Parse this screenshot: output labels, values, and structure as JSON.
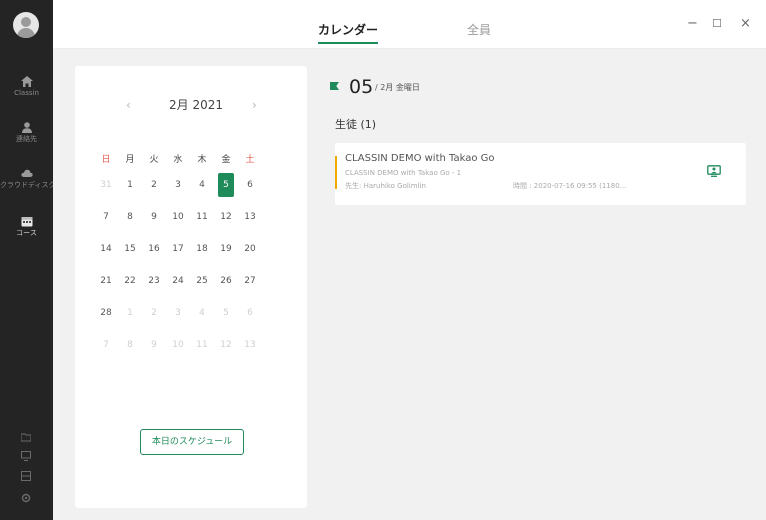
{
  "sidebar": {
    "items": [
      {
        "icon": "home-icon",
        "label": "Classin"
      },
      {
        "icon": "user-icon",
        "label": "連絡先"
      },
      {
        "icon": "cloud-icon",
        "label": "クラウドディスク"
      },
      {
        "icon": "calendar-icon",
        "label": "コース"
      }
    ],
    "bottom_icons": [
      "folder-icon",
      "monitor-icon",
      "grid-icon",
      "settings-icon"
    ]
  },
  "header": {
    "tabs": [
      {
        "label": "カレンダー",
        "active": true
      },
      {
        "label": "全員",
        "active": false
      }
    ],
    "window": {
      "minimize": "−",
      "maximize": "☐",
      "close": "×"
    }
  },
  "calendar": {
    "month_label": "2月 2021",
    "prev": "‹",
    "next": "›",
    "weekdays": [
      "日",
      "月",
      "火",
      "水",
      "木",
      "金",
      "土"
    ],
    "weeks": [
      [
        "31",
        "1",
        "2",
        "3",
        "4",
        "5",
        "6"
      ],
      [
        "7",
        "8",
        "9",
        "10",
        "11",
        "12",
        "13"
      ],
      [
        "14",
        "15",
        "16",
        "17",
        "18",
        "19",
        "20"
      ],
      [
        "21",
        "22",
        "23",
        "24",
        "25",
        "26",
        "27"
      ],
      [
        "28",
        "1",
        "2",
        "3",
        "4",
        "5",
        "6"
      ],
      [
        "7",
        "8",
        "9",
        "10",
        "11",
        "12",
        "13"
      ]
    ],
    "selected": "5",
    "today_button": "本日のスケジュール"
  },
  "day_view": {
    "day_number": "05",
    "day_subtitle": "/ 2月 金曜日",
    "section_title": "生徒 (1)",
    "lesson": {
      "title": "CLASSIN DEMO with Takao Go",
      "subtitle": "CLASSIN DEMO with Takao Go - 1",
      "teacher": "先生: Haruhiko Golimlin",
      "time": "時間 : 2020-07-16 09:55 (1180..."
    },
    "accent_color": "#1f8a5a",
    "marker_color": "#f0a900"
  }
}
